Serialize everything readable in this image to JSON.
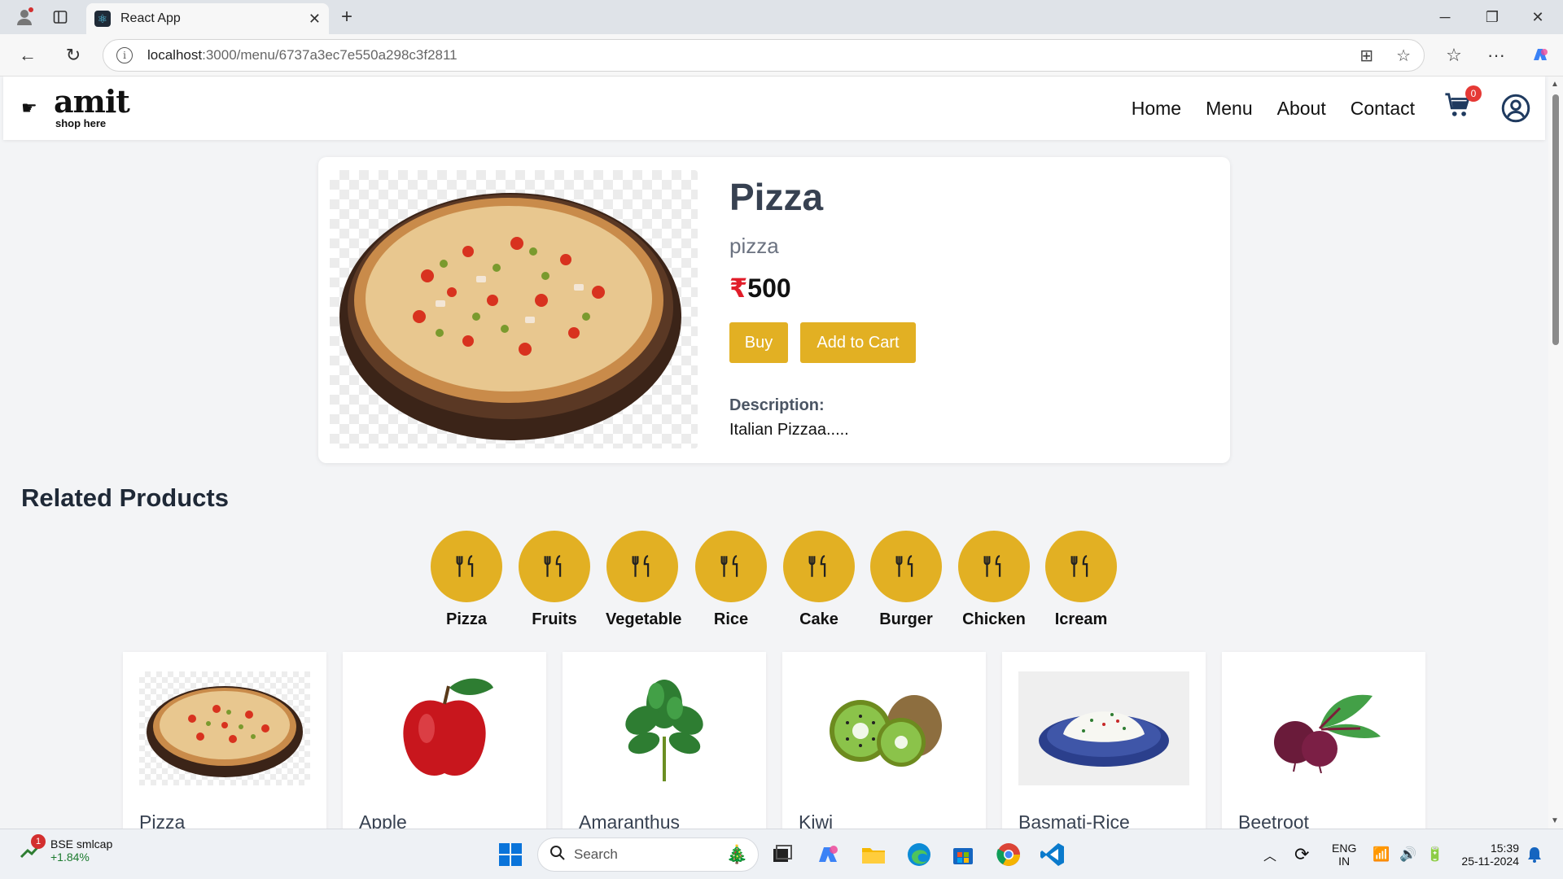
{
  "browser": {
    "tab_title": "React App",
    "url_host": "localhost",
    "url_path": ":3000/menu/6737a3ec7e550a298c3f2811"
  },
  "header": {
    "logo_word": "amit",
    "logo_tag": "shop here",
    "nav": [
      "Home",
      "Menu",
      "About",
      "Contact"
    ],
    "cart_count": "0"
  },
  "product": {
    "title": "Pizza",
    "subtitle": "pizza",
    "currency": "₹",
    "price": "500",
    "buy_label": "Buy",
    "add_label": "Add to Cart",
    "desc_label": "Description:",
    "description": "Italian Pizzaa....."
  },
  "related": {
    "title": "Related Products",
    "categories": [
      "Pizza",
      "Fruits",
      "Vegetable",
      "Rice",
      "Cake",
      "Burger",
      "Chicken",
      "Icream"
    ],
    "items": [
      "Pizza",
      "Apple",
      "Amaranthus",
      "Kiwi",
      "Basmati-Rice",
      "Beetroot"
    ]
  },
  "taskbar": {
    "stock_name": "BSE smlcap",
    "stock_change": "+1.84%",
    "stock_badge": "1",
    "search_placeholder": "Search",
    "lang_top": "ENG",
    "lang_bottom": "IN",
    "time": "15:39",
    "date": "25-11-2024"
  },
  "colors": {
    "accent": "#e2b023",
    "price_currency": "#e11d2a",
    "badge": "#e53935"
  }
}
